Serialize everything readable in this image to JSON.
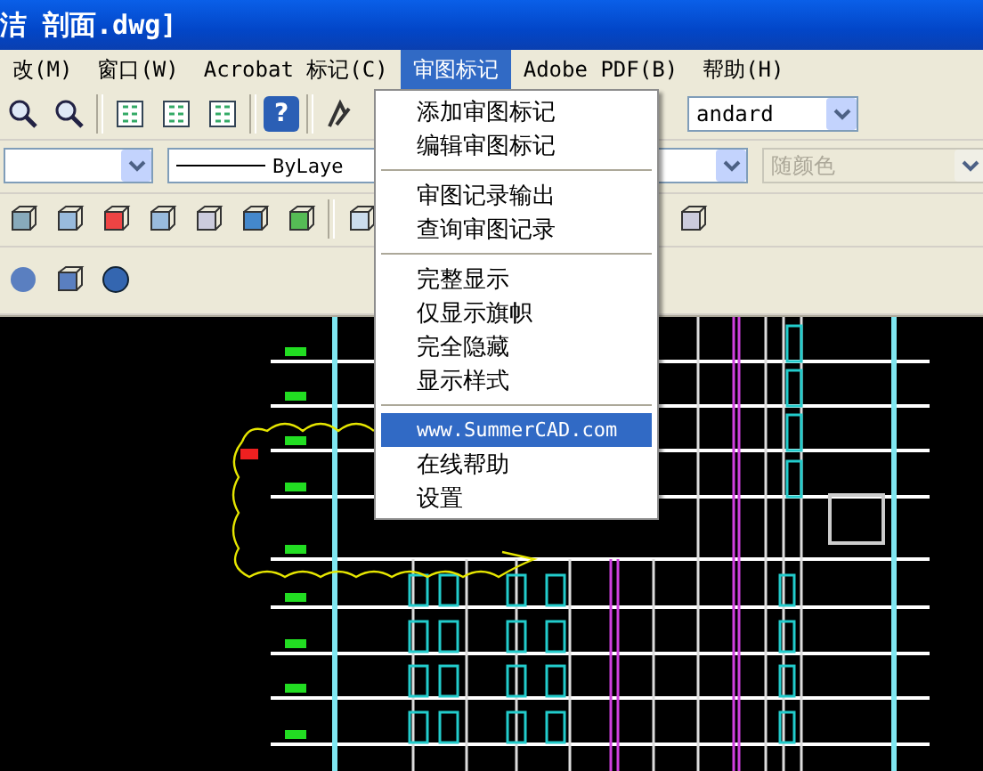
{
  "window": {
    "title": "洁 剖面.dwg]"
  },
  "menu_bar": [
    {
      "label": "改(M)",
      "selected": false
    },
    {
      "label": "窗口(W)",
      "selected": false
    },
    {
      "label": "Acrobat 标记(C)",
      "selected": false
    },
    {
      "label": "审图标记",
      "selected": true
    },
    {
      "label": "Adobe PDF(B)",
      "selected": false
    },
    {
      "label": "帮助(H)",
      "selected": false
    }
  ],
  "toolbar": {
    "help_button": "?",
    "text_style": "andard",
    "linetype": "ByLaye",
    "color": {
      "value": "随颜色",
      "disabled": true
    }
  },
  "dropdown_menu": {
    "groups": [
      [
        {
          "label": "添加审图标记",
          "selected": false
        },
        {
          "label": "编辑审图标记",
          "selected": false
        }
      ],
      [
        {
          "label": "审图记录输出",
          "selected": false
        },
        {
          "label": "查询审图记录",
          "selected": false
        }
      ],
      [
        {
          "label": "完整显示",
          "selected": false
        },
        {
          "label": "仅显示旗帜",
          "selected": false
        },
        {
          "label": "完全隐藏",
          "selected": false
        },
        {
          "label": "显示样式",
          "selected": false
        }
      ],
      [
        {
          "label": "www.SummerCAD.com",
          "selected": true
        },
        {
          "label": "在线帮助",
          "selected": false
        },
        {
          "label": "设置",
          "selected": false
        }
      ]
    ]
  }
}
